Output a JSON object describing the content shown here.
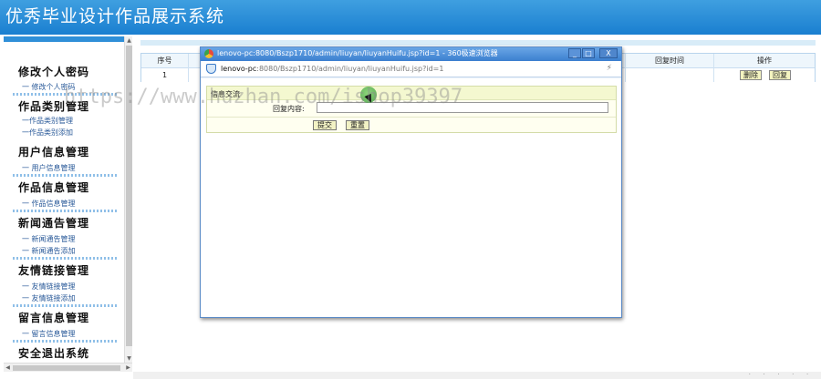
{
  "header": {
    "title": "优秀毕业设计作品展示系统"
  },
  "sidebar": {
    "groups": [
      {
        "title": "修改个人密码",
        "items": [
          "修改个人密码"
        ]
      },
      {
        "title": "作品类别管理",
        "items": [
          "作品类别管理",
          "作品类别添加"
        ]
      },
      {
        "title": "用户信息管理",
        "items": [
          "用户信息管理"
        ]
      },
      {
        "title": "作品信息管理",
        "items": [
          "作品信息管理"
        ]
      },
      {
        "title": "新闻通告管理",
        "items": [
          "新闻通告管理",
          "新闻通告添加"
        ]
      },
      {
        "title": "友情链接管理",
        "items": [
          "友情链接管理",
          "友情链接添加"
        ]
      },
      {
        "title": "留言信息管理",
        "items": [
          "留言信息管理"
        ]
      },
      {
        "title": "安全退出系统",
        "items": []
      }
    ],
    "item_prefix": "一"
  },
  "table": {
    "headers": {
      "seq": "序号",
      "reply_time": "回复时间",
      "ops": "操作"
    },
    "rows": [
      {
        "seq": "1",
        "delete_label": "删除",
        "reply_label": "回复"
      }
    ]
  },
  "popup": {
    "title": "lenovo-pc:8080/Bszp1710/admin/liuyan/liuyanHuifu.jsp?id=1 - 360极速浏览器",
    "url_host": "lenovo-pc",
    "url_rest": ":8080/Bszp1710/admin/liuyan/liuyanHuifu.jsp?id=1",
    "form_title": "信息交流",
    "reply_label": "回复内容:",
    "reply_value": "",
    "submit_label": "提交",
    "reset_label": "重置",
    "btn_minimize": "_",
    "btn_maximize": "□",
    "btn_close": "X",
    "bolt": "⚡"
  },
  "watermark": "https://www.huzhan.com/ishop39397",
  "colors": {
    "header": "#1a7fd0",
    "accent": "#2f8fd8"
  }
}
